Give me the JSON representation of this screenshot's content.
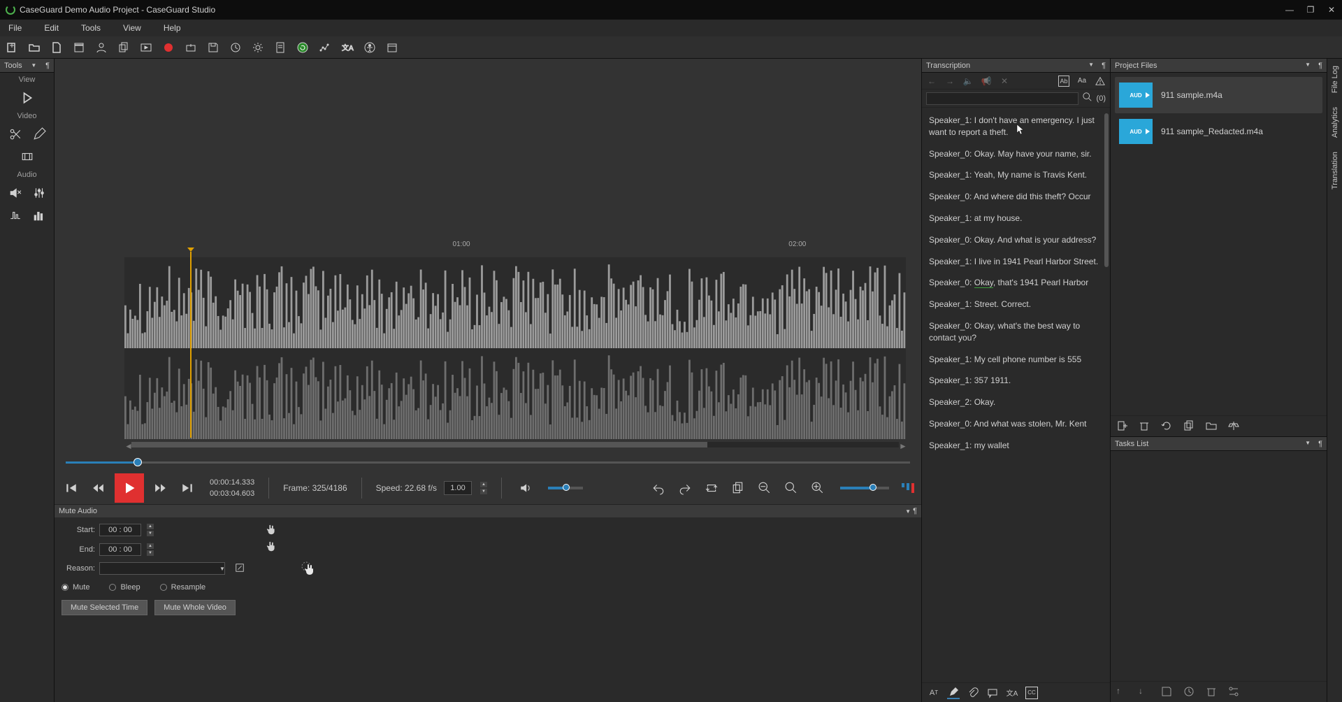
{
  "app": {
    "title": "CaseGuard Demo Audio Project - CaseGuard Studio"
  },
  "menu": [
    "File",
    "Edit",
    "Tools",
    "View",
    "Help"
  ],
  "left_panel": {
    "title": "Tools",
    "sections": {
      "view": "View",
      "video": "Video",
      "audio": "Audio"
    }
  },
  "ruler": {
    "t1": "01:00",
    "t2": "02:00"
  },
  "transport": {
    "time_current": "00:00:14.333",
    "time_total": "00:03:04.603",
    "frame_label": "Frame: 325/4186",
    "speed_label": "Speed: 22.68 f/s",
    "speed_value": "1.00"
  },
  "mute": {
    "title": "Mute Audio",
    "start_label": "Start:",
    "end_label": "End:",
    "start_val": "00 : 00",
    "end_val": "00 : 00",
    "reason_label": "Reason:",
    "opt_mute": "Mute",
    "opt_bleep": "Bleep",
    "opt_resample": "Resample",
    "btn_sel": "Mute Selected Time",
    "btn_whole": "Mute Whole Video"
  },
  "transcription": {
    "title": "Transcription",
    "search_count": "(0)",
    "entries": [
      {
        "sp": "Speaker_1:",
        "txt": " I don't have an emergency. I just want to report a theft."
      },
      {
        "sp": "Speaker_0:",
        "txt": " Okay. May have your name, sir."
      },
      {
        "sp": "Speaker_1:",
        "txt": " Yeah, My name is Travis Kent."
      },
      {
        "sp": "Speaker_0:",
        "txt": " And where did this theft? Occur"
      },
      {
        "sp": "Speaker_1:",
        "txt": " at my house."
      },
      {
        "sp": "Speaker_0:",
        "txt": " Okay. And what is your address?"
      },
      {
        "sp": "Speaker_1:",
        "txt": " I live in 1941 Pearl Harbor Street."
      },
      {
        "sp": "Speaker_0:",
        "txt": " ",
        "hl": "Okay",
        "txt2": ", that's 1941 Pearl Harbor"
      },
      {
        "sp": "Speaker_1:",
        "txt": " Street. Correct."
      },
      {
        "sp": "Speaker_0:",
        "txt": " Okay, what's the best way to contact you?"
      },
      {
        "sp": "Speaker_1:",
        "txt": " My cell phone number is 555"
      },
      {
        "sp": "Speaker_1:",
        "txt": " 357 1911."
      },
      {
        "sp": "Speaker_2:",
        "txt": " Okay."
      },
      {
        "sp": "Speaker_0:",
        "txt": " And what was stolen, Mr. Kent"
      },
      {
        "sp": "Speaker_1:",
        "txt": " my wallet"
      }
    ]
  },
  "project": {
    "title": "Project Files",
    "files": [
      {
        "name": "911 sample.m4a",
        "thumb": "AUD"
      },
      {
        "name": "911 sample_Redacted.m4a",
        "thumb": "AUD"
      }
    ]
  },
  "tasks": {
    "title": "Tasks List"
  },
  "right_tabs": [
    "File Log",
    "Analytics",
    "Translation"
  ]
}
